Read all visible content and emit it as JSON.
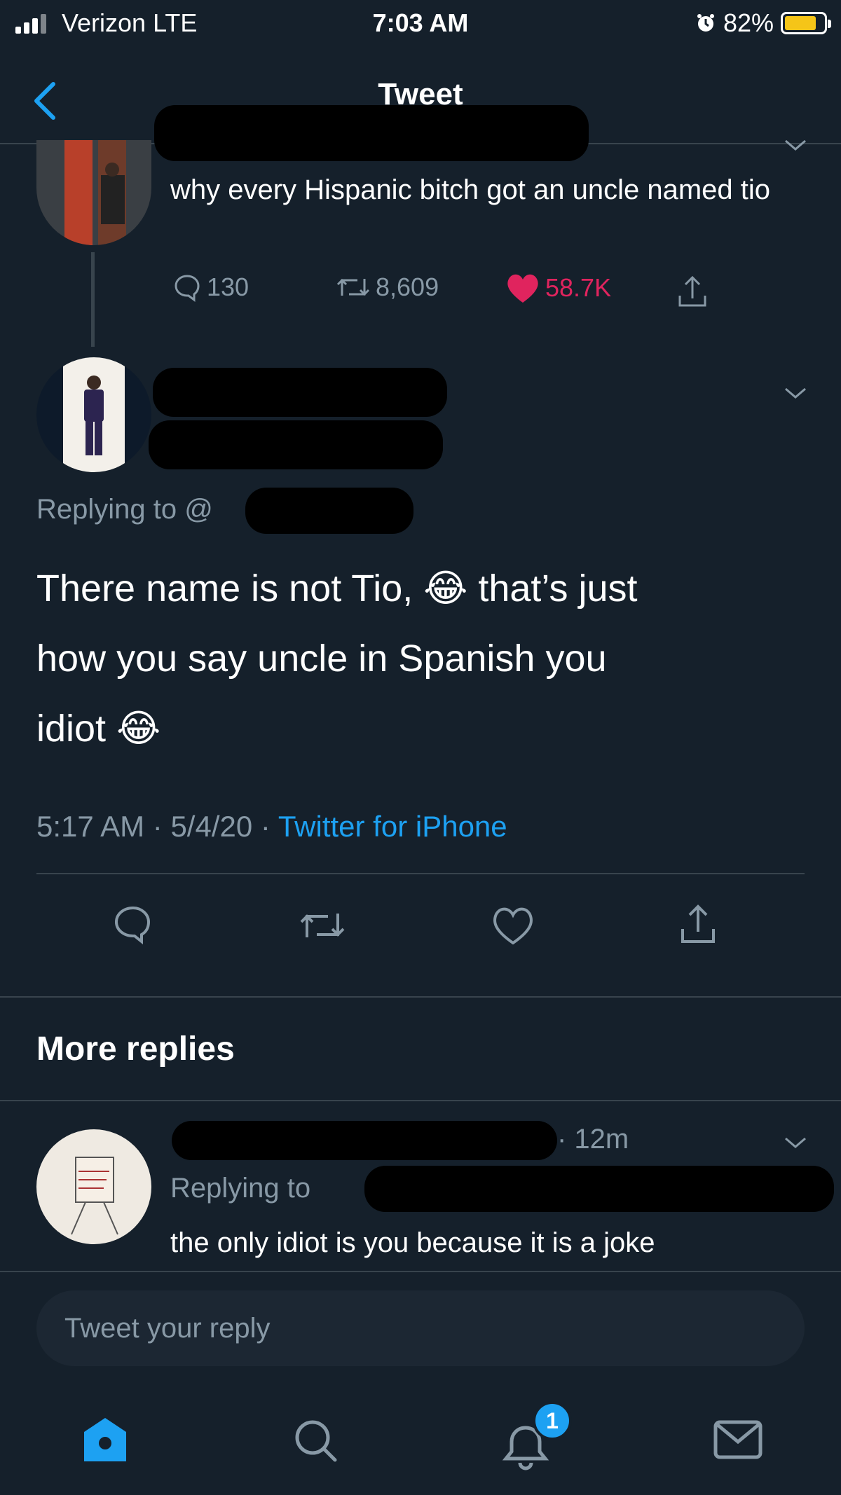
{
  "status_bar": {
    "carrier": "Verizon  LTE",
    "time": "7:03 AM",
    "battery": "82%",
    "battery_level": 0.82
  },
  "nav": {
    "title": "Tweet"
  },
  "parent_tweet": {
    "text": "why every Hispanic bitch got an uncle named tio",
    "replies": "130",
    "retweets": "8,609",
    "likes": "58.7K"
  },
  "main_tweet": {
    "replying_to": "Replying to @",
    "text_line1": "There name is not Tio, 😂 that’s just",
    "text_line2": "how you say uncle in Spanish you",
    "text_line3": "idiot 😂",
    "time": "5:17 AM",
    "date": "5/4/20",
    "source": "Twitter for iPhone",
    "sep": "·"
  },
  "more_replies": {
    "heading": "More replies",
    "reply": {
      "time": "· 12m",
      "replying_to": "Replying to",
      "text": "the only idiot is you because it is a joke"
    }
  },
  "compose": {
    "placeholder": "Tweet your reply"
  },
  "tab_bar": {
    "notification_count": "1"
  },
  "colors": {
    "background": "#15202b",
    "accent": "#1da1f2",
    "like": "#e0245e",
    "muted": "#8899a6",
    "divider": "#38444d"
  }
}
